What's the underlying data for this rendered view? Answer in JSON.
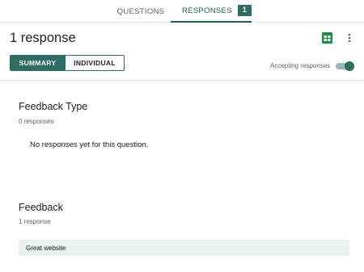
{
  "tabs": {
    "questions_label": "QUESTIONS",
    "responses_label": "RESPONSES",
    "responses_count": "1"
  },
  "header": {
    "title": "1 response",
    "sheets_icon": "google-sheets-icon",
    "more_icon": "more-vert-icon"
  },
  "view_toggle": {
    "summary_label": "SUMMARY",
    "individual_label": "INDIVIDUAL",
    "selected": "summary"
  },
  "accepting": {
    "label": "Accepting responses",
    "enabled": true
  },
  "questions": [
    {
      "title": "Feedback Type",
      "count": "0 responses",
      "empty_message": "No responses yet for this question."
    },
    {
      "title": "Feedback",
      "count": "1 response",
      "answers": [
        "Great website"
      ]
    }
  ],
  "colors": {
    "accent": "#2e6d63",
    "accent_light": "#93b7b1",
    "answer_bg": "#e8f2ef",
    "sheets_green": "#1e8e3e"
  }
}
